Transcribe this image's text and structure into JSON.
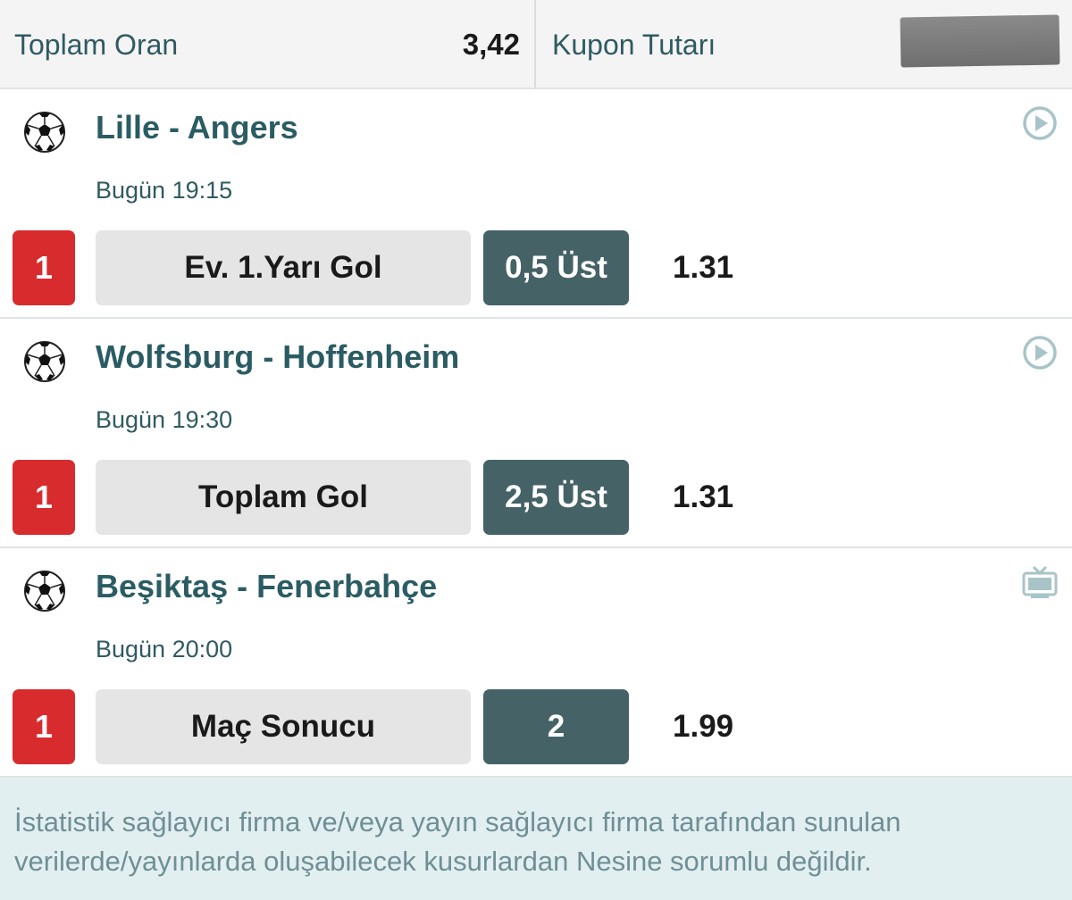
{
  "summary": {
    "total_odds_label": "Toplam Oran",
    "total_odds_value": "3,42",
    "coupon_amount_label": "Kupon Tutarı"
  },
  "matches": [
    {
      "title": "Lille - Angers",
      "time": "Bugün 19:15",
      "pick": "1",
      "market": "Ev. 1.Yarı Gol",
      "selection": "0,5 Üst",
      "odds": "1.31",
      "icon": "play-circle-icon"
    },
    {
      "title": "Wolfsburg - Hoffenheim",
      "time": "Bugün 19:30",
      "pick": "1",
      "market": "Toplam Gol",
      "selection": "2,5 Üst",
      "odds": "1.31",
      "icon": "play-circle-icon"
    },
    {
      "title": "Beşiktaş - Fenerbahçe",
      "time": "Bugün 20:00",
      "pick": "1",
      "market": "Maç Sonucu",
      "selection": "2",
      "odds": "1.99",
      "icon": "tv-icon"
    }
  ],
  "disclaimer": "İstatistik sağlayıcı firma ve/veya yayın sağlayıcı firma tarafından sunulan verilerde/yayınlarda oluşabilecek kusurlardan Nesine sorumlu değildir.",
  "colors": {
    "pick_red": "#d82b2e",
    "selection_teal": "#456267",
    "title_teal": "#2b5c63",
    "disclaimer_bg": "#e2eff1"
  }
}
